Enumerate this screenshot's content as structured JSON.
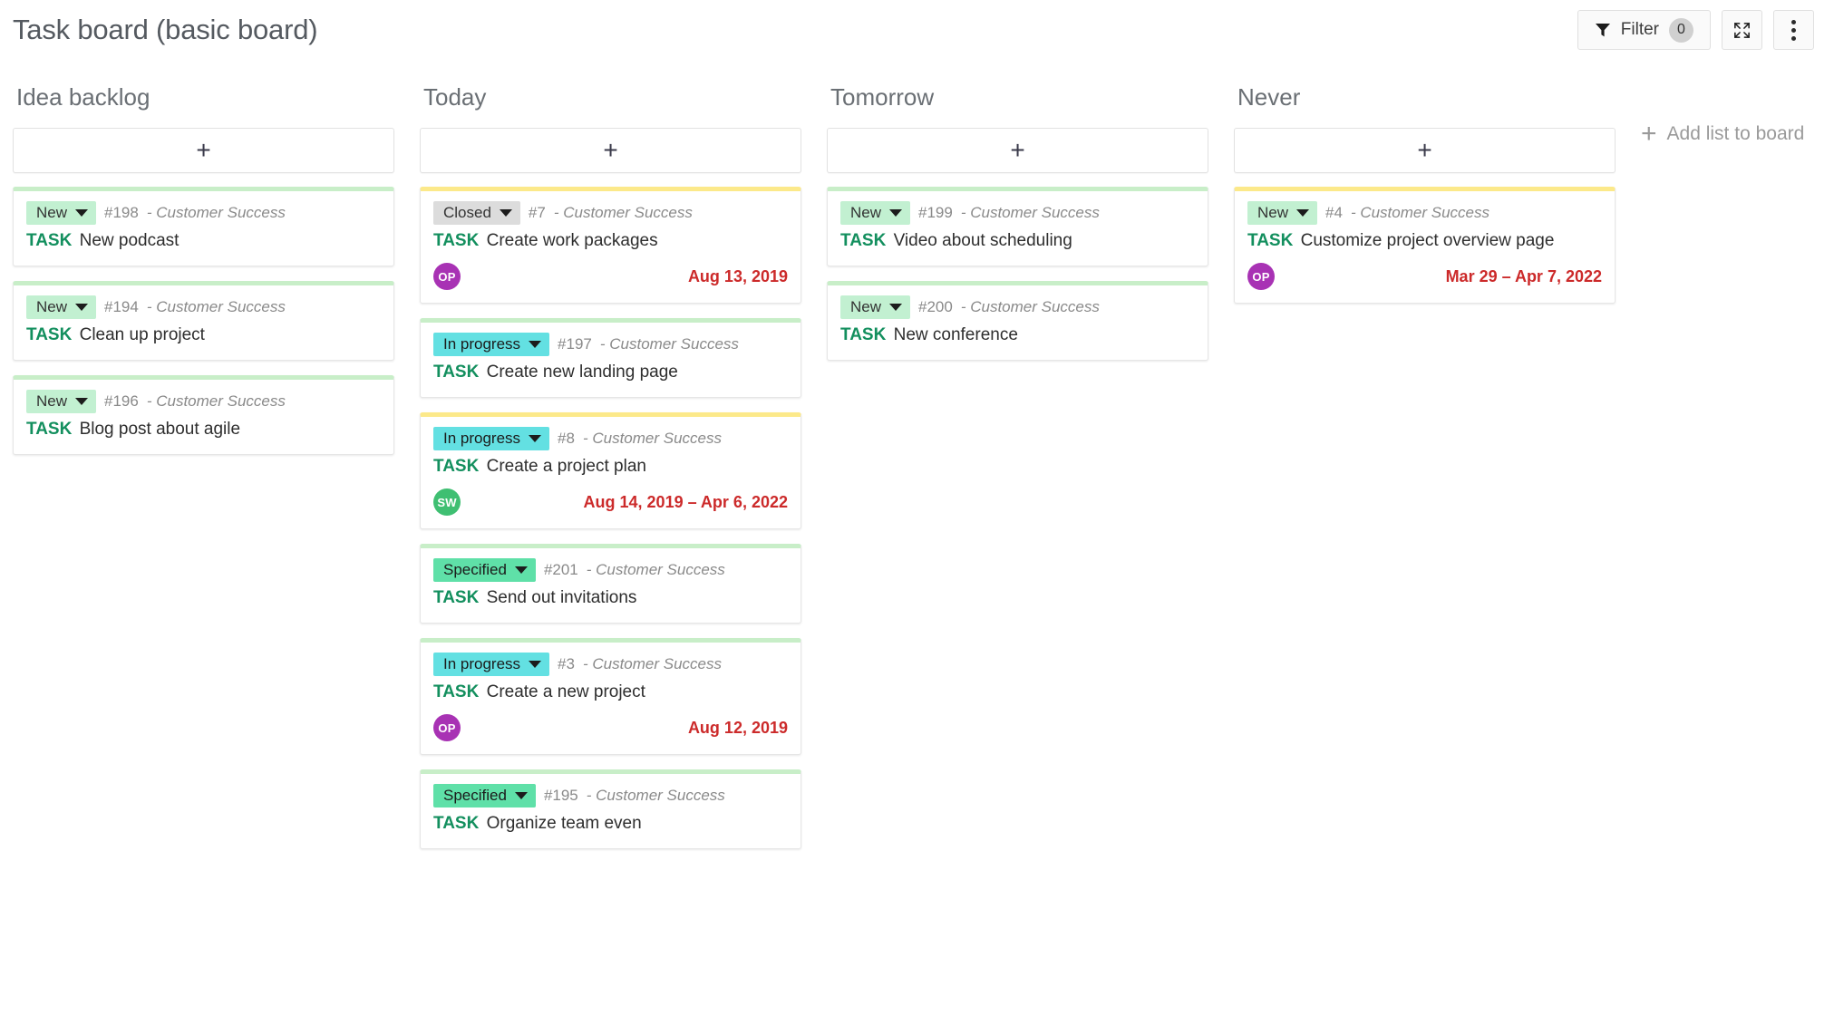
{
  "header": {
    "title": "Task board (basic board)",
    "filter_label": "Filter",
    "filter_count": "0",
    "filter_icon": "funnel-icon",
    "fullscreen_icon": "expand-icon",
    "more_icon": "kebab-menu-icon"
  },
  "board": {
    "add_list_label": "Add list to board",
    "add_card_glyph": "+",
    "add_list_glyph": "+",
    "columns": [
      {
        "title": "Idea backlog",
        "cards": [
          {
            "accent": "green",
            "status": "New",
            "status_style": "new",
            "id": "#198",
            "project": "- Customer Success",
            "type": "TASK",
            "subject": "New podcast",
            "assignee": null,
            "assignee_color": null,
            "date": null
          },
          {
            "accent": "green",
            "status": "New",
            "status_style": "new",
            "id": "#194",
            "project": "- Customer Success",
            "type": "TASK",
            "subject": "Clean up project",
            "assignee": null,
            "assignee_color": null,
            "date": null
          },
          {
            "accent": "green",
            "status": "New",
            "status_style": "new",
            "id": "#196",
            "project": "- Customer Success",
            "type": "TASK",
            "subject": "Blog post about agile",
            "assignee": null,
            "assignee_color": null,
            "date": null
          }
        ]
      },
      {
        "title": "Today",
        "cards": [
          {
            "accent": "yellow",
            "status": "Closed",
            "status_style": "closed",
            "id": "#7",
            "project": "- Customer Success",
            "type": "TASK",
            "subject": "Create work packages",
            "assignee": "OP",
            "assignee_color": "op",
            "date": "Aug 13, 2019"
          },
          {
            "accent": "green",
            "status": "In progress",
            "status_style": "inprogress",
            "id": "#197",
            "project": "- Customer Success",
            "type": "TASK",
            "subject": "Create new landing page",
            "assignee": null,
            "assignee_color": null,
            "date": null
          },
          {
            "accent": "yellow",
            "status": "In progress",
            "status_style": "inprogress",
            "id": "#8",
            "project": "- Customer Success",
            "type": "TASK",
            "subject": "Create a project plan",
            "assignee": "SW",
            "assignee_color": "sw",
            "date": "Aug 14, 2019 – Apr 6, 2022"
          },
          {
            "accent": "green",
            "status": "Specified",
            "status_style": "specified",
            "id": "#201",
            "project": "- Customer Success",
            "type": "TASK",
            "subject": "Send out invitations",
            "assignee": null,
            "assignee_color": null,
            "date": null
          },
          {
            "accent": "green",
            "status": "In progress",
            "status_style": "inprogress",
            "id": "#3",
            "project": "- Customer Success",
            "type": "TASK",
            "subject": "Create a new project",
            "assignee": "OP",
            "assignee_color": "op",
            "date": "Aug 12, 2019"
          },
          {
            "accent": "green",
            "status": "Specified",
            "status_style": "specified",
            "id": "#195",
            "project": "- Customer Success",
            "type": "TASK",
            "subject": "Organize team even",
            "assignee": null,
            "assignee_color": null,
            "date": null
          }
        ]
      },
      {
        "title": "Tomorrow",
        "cards": [
          {
            "accent": "green",
            "status": "New",
            "status_style": "new",
            "id": "#199",
            "project": "- Customer Success",
            "type": "TASK",
            "subject": "Video about scheduling",
            "assignee": null,
            "assignee_color": null,
            "date": null
          },
          {
            "accent": "green",
            "status": "New",
            "status_style": "new",
            "id": "#200",
            "project": "- Customer Success",
            "type": "TASK",
            "subject": "New conference",
            "assignee": null,
            "assignee_color": null,
            "date": null
          }
        ]
      },
      {
        "title": "Never",
        "cards": [
          {
            "accent": "yellow",
            "status": "New",
            "status_style": "new",
            "id": "#4",
            "project": "- Customer Success",
            "type": "TASK",
            "subject": "Customize project overview page",
            "assignee": "OP",
            "assignee_color": "op",
            "date": "Mar 29 – Apr 7, 2022"
          }
        ]
      }
    ]
  },
  "colors": {
    "accent_green": "#c8eec8",
    "accent_yellow": "#fce98a",
    "status_new": "#c2f0d1",
    "status_in_progress": "#63e0e2",
    "status_specified": "#5fe0a8",
    "status_closed": "#dcdcdc",
    "task_type": "#138f5e",
    "date_overdue": "#cc2a2a",
    "avatar_op": "#a832b4",
    "avatar_sw": "#3fbf72"
  }
}
